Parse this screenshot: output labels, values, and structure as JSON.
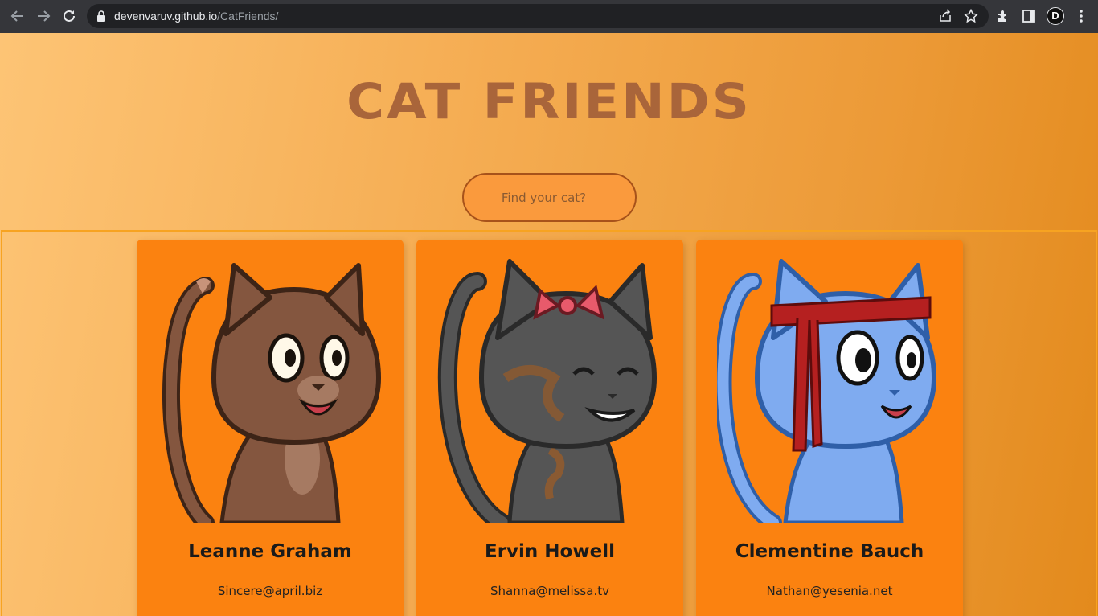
{
  "browser": {
    "url_host": "devenvaruv.github.io",
    "url_path": "/CatFriends/",
    "profile_initial": "D",
    "colors": {
      "chrome": "#35363a",
      "omnibox": "#202124"
    }
  },
  "page": {
    "title": "Cat Friends",
    "search_placeholder": "Find your cat?",
    "colors": {
      "title": "#a9653a",
      "card": "#fb8210",
      "search_border": "#a7521a"
    }
  },
  "cards": [
    {
      "name": "Leanne Graham",
      "email": "Sincere@april.biz",
      "icon": "brown-cat-icon"
    },
    {
      "name": "Ervin Howell",
      "email": "Shanna@melissa.tv",
      "icon": "grey-cat-with-bow-icon"
    },
    {
      "name": "Clementine Bauch",
      "email": "Nathan@yesenia.net",
      "icon": "blue-cat-with-headband-icon"
    }
  ]
}
